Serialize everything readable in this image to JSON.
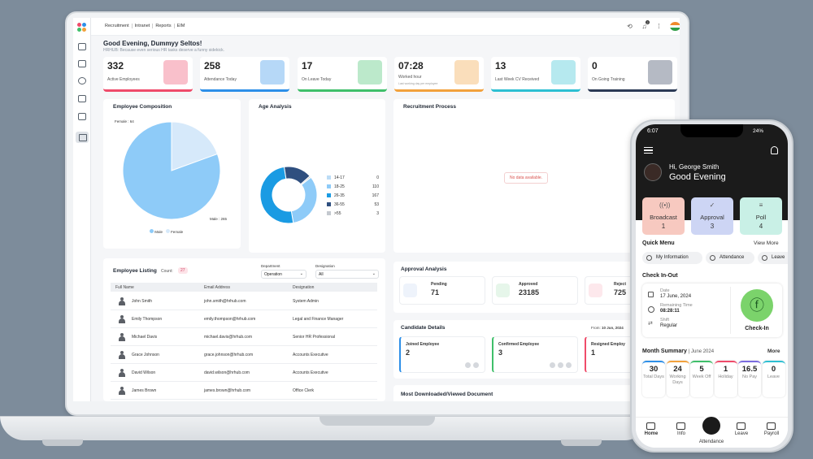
{
  "nav": {
    "items": [
      "Recruitment",
      "Intranet",
      "Reports",
      "EIM"
    ]
  },
  "header": {
    "notification_count": "2"
  },
  "greeting": {
    "title": "Good Evening, Dummyy Seltos!",
    "subtitle": "HRHUB: Because even serious HR tasks deserve a funny sidekick."
  },
  "stats": [
    {
      "value": "332",
      "label": "Active Employees",
      "color": "#ef4b6a"
    },
    {
      "value": "258",
      "label": "Attendance Today",
      "color": "#2d8fe8"
    },
    {
      "value": "17",
      "label": "On Leave Today",
      "color": "#3fbf6a"
    },
    {
      "value": "07:28",
      "label": "Worked hour",
      "sublabel": "Last working day per employee",
      "color": "#f2a13c"
    },
    {
      "value": "13",
      "label": "Last Week CV Received",
      "color": "#2dbfd2"
    },
    {
      "value": "0",
      "label": "On Going Training",
      "color": "#2b3a55"
    }
  ],
  "composition": {
    "title": "Employee Composition",
    "female_label": "Female : 64",
    "male_label": "Male : 265",
    "legend": [
      "Male",
      "Female"
    ],
    "male": 265,
    "female": 64,
    "colors": {
      "male": "#8ecbf8",
      "female": "#d6e9fa"
    }
  },
  "age": {
    "title": "Age Analysis",
    "rows": [
      {
        "range": "14-17",
        "value": 0,
        "color": "#bcdcf6"
      },
      {
        "range": "18-25",
        "value": 110,
        "color": "#8ecbf8"
      },
      {
        "range": "26-35",
        "value": 167,
        "color": "#1a9be3"
      },
      {
        "range": "36-55",
        "value": 53,
        "color": "#2f4f7f"
      },
      {
        "range": ">55",
        "value": 3,
        "color": "#c4c9cf"
      }
    ]
  },
  "recruitment": {
    "title": "Recruitment Process",
    "empty": "No data available."
  },
  "listing": {
    "title": "Employee Listing",
    "count_label": "Count:",
    "count": "27",
    "department_label": "Department",
    "department_value": "Operation",
    "designation_label": "Designation",
    "designation_value": "All",
    "columns": [
      "Full Name",
      "Email Address",
      "Designation"
    ],
    "rows": [
      {
        "name": "John Smith",
        "email": "john.smith@hrhub.com",
        "designation": "System Admin"
      },
      {
        "name": "Emily Thompson",
        "email": "emily.thompson@hrhub.com",
        "designation": "Legal and Finance Manager"
      },
      {
        "name": "Michael Davis",
        "email": "michael.davis@hrhub.com",
        "designation": "Senior HR Professional"
      },
      {
        "name": "Grace Johnson",
        "email": "grace.johnson@hrhub.com",
        "designation": "Accounts Executive"
      },
      {
        "name": "David Wilson",
        "email": "david.wilson@hrhub.com",
        "designation": "Accounts Executive"
      },
      {
        "name": "James Brown",
        "email": "james.brown@hrhub.com",
        "designation": "Office Clerk"
      }
    ]
  },
  "approval": {
    "title": "Approval Analysis",
    "items": [
      {
        "label": "Pending",
        "value": "71"
      },
      {
        "label": "Approved",
        "value": "23185"
      },
      {
        "label": "Reject",
        "value": "725"
      }
    ]
  },
  "candidate": {
    "title": "Candidate Details",
    "from_label": "From:",
    "from_value": "10 Jun, 2024",
    "items": [
      {
        "label": "Joined Employee",
        "value": "2",
        "color": "#2d8fe8"
      },
      {
        "label": "Confirmed Employee",
        "value": "3",
        "color": "#3fbf6a"
      },
      {
        "label": "Resigned Employ",
        "value": "1",
        "color": "#ef4b6a"
      }
    ]
  },
  "downloads": {
    "title": "Most Downloaded/Viewed Document"
  },
  "phone": {
    "time": "6:07",
    "battery": "24%",
    "greeting_name": "Hi, George Smith",
    "greeting": "Good Evening",
    "tiles": [
      {
        "label": "Broadcast",
        "value": "1",
        "color": "#f7c9c0"
      },
      {
        "label": "Approval",
        "value": "3",
        "color": "#cdd5f4"
      },
      {
        "label": "Poll",
        "value": "4",
        "color": "#c9f0e6"
      }
    ],
    "quick_menu": "Quick Menu",
    "view_more": "View More",
    "chips": [
      "My Information",
      "Attendance",
      "Leave"
    ],
    "checkin_title": "Check In-Out",
    "date_label": "Date",
    "date_value": "17 June, 2024",
    "remaining_label": "Remaining Time",
    "remaining_value": "08:28:11",
    "shift_label": "Shift",
    "shift_value": "Regular",
    "checkin_btn": "Check-In",
    "month_title": "Month Summary",
    "month_sub": "| June 2024",
    "more": "More",
    "summary": [
      {
        "value": "30",
        "label": "Total Days",
        "color": "#2d8fe8"
      },
      {
        "value": "24",
        "label": "Working Days",
        "color": "#f2a13c"
      },
      {
        "value": "5",
        "label": "Week Off",
        "color": "#3fbf6a"
      },
      {
        "value": "1",
        "label": "Holiday",
        "color": "#ef4b6a"
      },
      {
        "value": "16.5",
        "label": "No Pay",
        "color": "#7b6be0"
      },
      {
        "value": "0",
        "label": "Leave",
        "color": "#2dbfd2"
      }
    ],
    "nav": [
      "Home",
      "Info",
      "Attendance",
      "Leave",
      "Payroll"
    ]
  }
}
